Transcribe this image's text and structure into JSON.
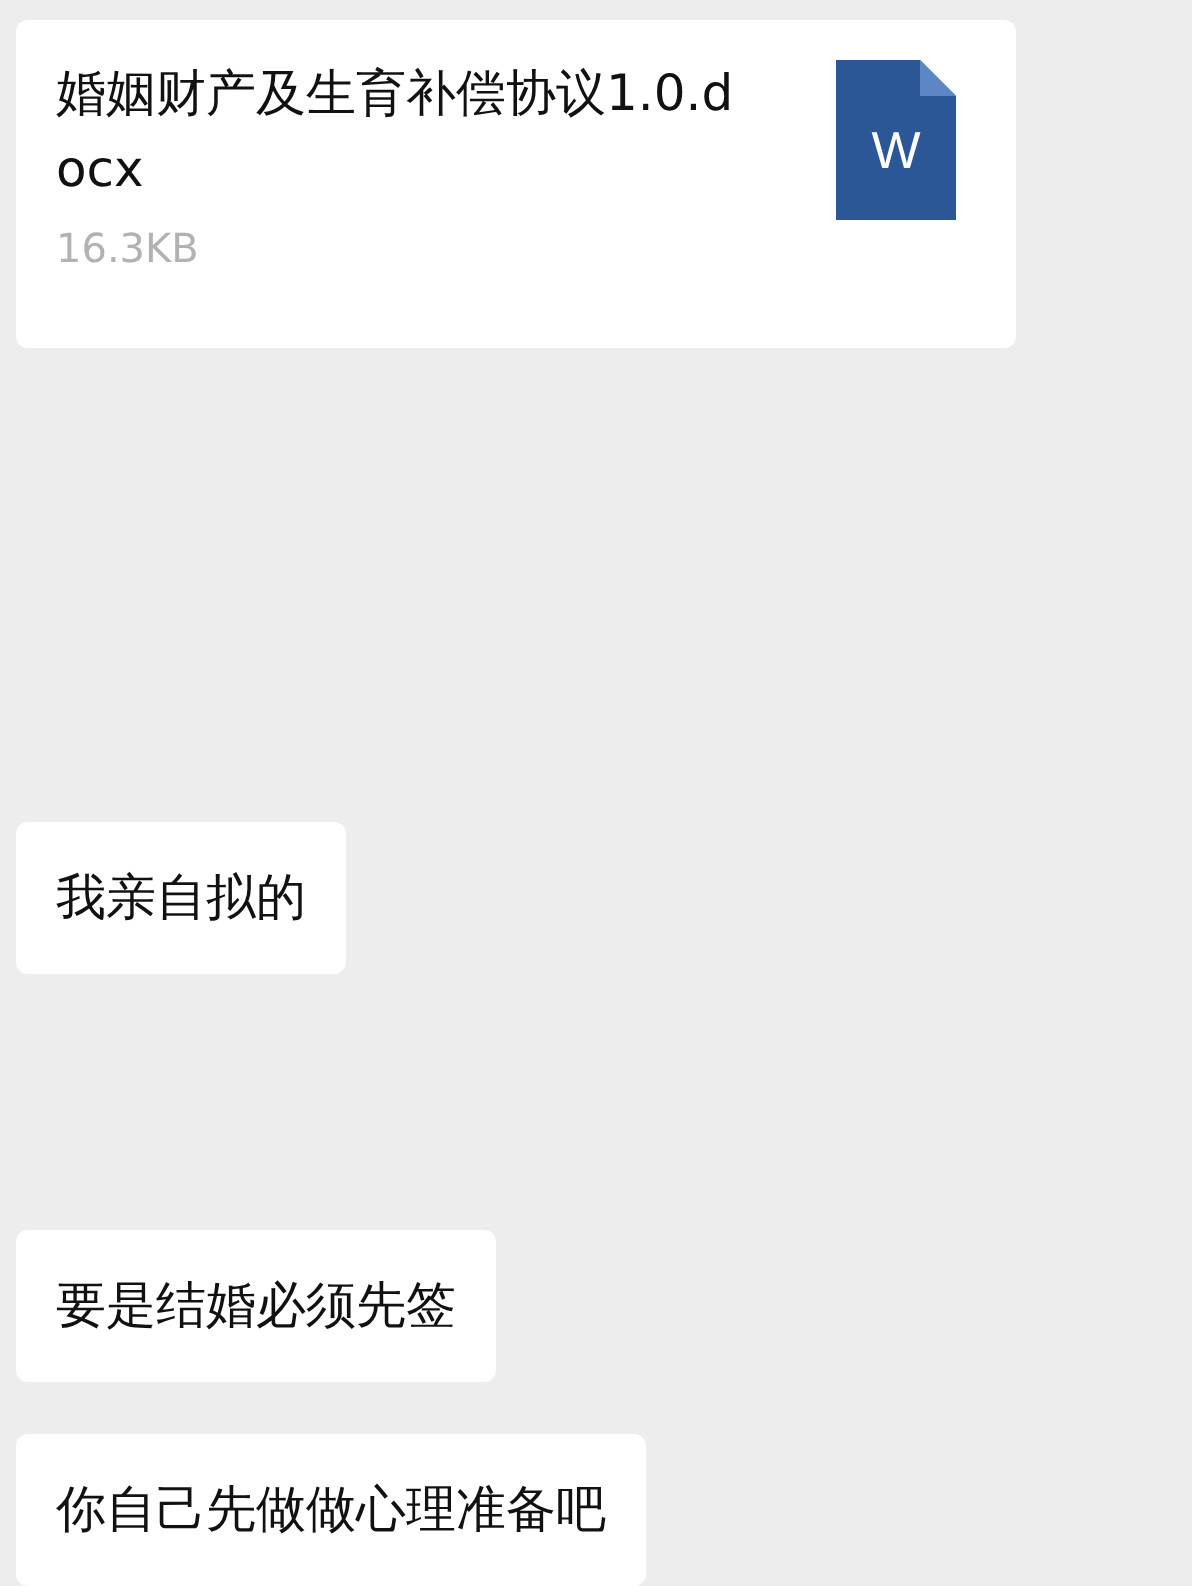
{
  "file_message": {
    "file_name": "婚姻财产及生育补偿协议1.0.docx",
    "file_size": "16.3KB",
    "icon_letter": "W"
  },
  "messages": [
    {
      "text": "我亲自拟的"
    },
    {
      "text": "要是结婚必须先签"
    },
    {
      "text": "你自己先做做心理准备吧"
    }
  ]
}
